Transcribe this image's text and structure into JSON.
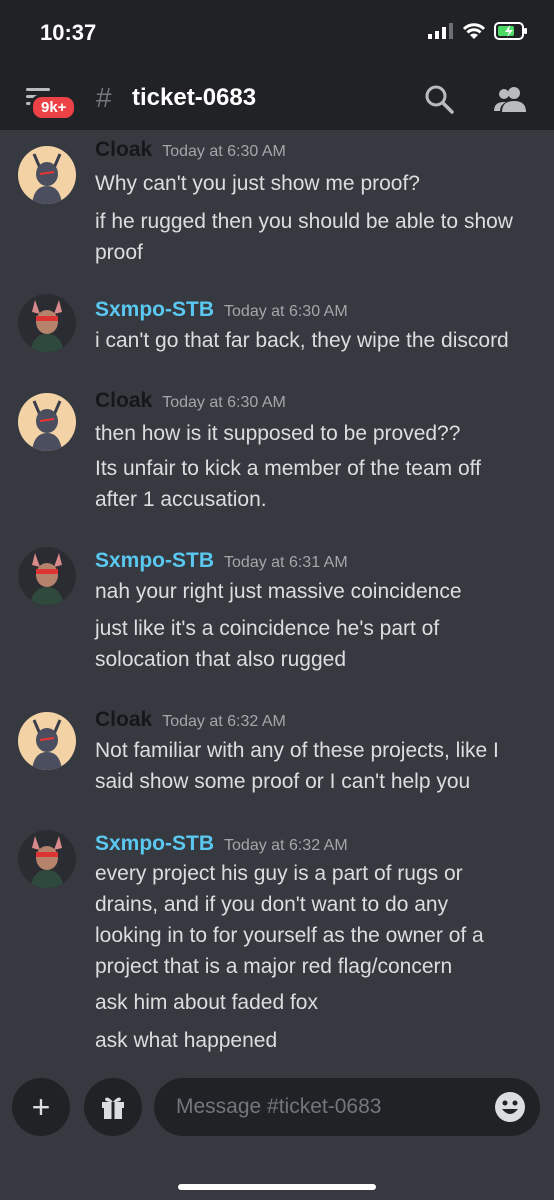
{
  "status_bar": {
    "time": "10:37"
  },
  "header": {
    "badge": "9k+",
    "channel_name": "ticket-0683"
  },
  "messages": [
    {
      "author": "Cloak",
      "timestamp": "Today at 6:30 AM",
      "lines": [
        "Why can't you just show me proof?",
        "if he rugged then you should be able to show",
        "proof"
      ]
    },
    {
      "author": "Sxmpo-STB",
      "timestamp": "Today at 6:30 AM",
      "lines": [
        "i can't go that far back, they wipe the discord"
      ]
    },
    {
      "author": "Cloak",
      "timestamp": "Today at 6:30 AM",
      "lines": [
        "then how is it supposed to be proved??",
        "Its unfair to kick a member of the team off",
        "after 1 accusation."
      ]
    },
    {
      "author": "Sxmpo-STB",
      "timestamp": "Today at 6:31 AM",
      "lines": [
        "nah your right just massive coincidence",
        "just like it's a coincidence he's part of",
        "solocation that also rugged"
      ]
    },
    {
      "author": "Cloak",
      "timestamp": "Today at 6:32 AM",
      "lines": [
        "Not familiar with any of these projects, like I",
        "said show some proof or I can't help you"
      ]
    },
    {
      "author": "Sxmpo-STB",
      "timestamp": "Today at 6:32 AM",
      "lines": [
        "every project his guy is a part of rugs or",
        "drains, and if you don't want to do any",
        "looking in to for yourself as the owner of a",
        "project that is a major red flag/concern",
        "ask him about faded fox",
        "ask what happened"
      ]
    }
  ],
  "composer": {
    "placeholder": "Message #ticket-0683"
  },
  "colors": {
    "background": "#36393f",
    "bar": "#202225",
    "badge": "#ed4245",
    "sx_name": "#5ac8f0",
    "cloak_name": "#16171a"
  }
}
